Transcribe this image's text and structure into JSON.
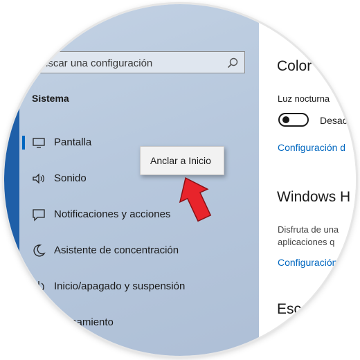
{
  "sidebar": {
    "search_placeholder": "uscar una configuración",
    "section_title": "Sistema",
    "items": [
      {
        "label": "Pantalla",
        "icon": "monitor-icon"
      },
      {
        "label": "Sonido",
        "icon": "speaker-icon"
      },
      {
        "label": "Notificaciones y acciones",
        "icon": "notification-icon"
      },
      {
        "label": "Asistente de concentración",
        "icon": "moon-icon"
      },
      {
        "label": "Inicio/apagado y suspensión",
        "icon": "power-icon"
      },
      {
        "label": "ncenamiento",
        "icon": "storage-icon"
      }
    ]
  },
  "context_menu": {
    "item": "Anclar a Inicio"
  },
  "main": {
    "color_heading": "Color",
    "night_light_label": "Luz nocturna",
    "night_light_state": "Desac",
    "config_link_1": "Configuración d",
    "windows_heading": "Windows H",
    "description_line1": "Disfruta de una",
    "description_line2": "aplicaciones q",
    "config_link_2": "Configuración",
    "esc_heading": "Esc"
  },
  "colors": {
    "accent": "#0067c0",
    "annotation_arrow": "#e8242b",
    "sidebar_bg": "#b7c8dd",
    "window_edge": "#1f5fa8"
  }
}
